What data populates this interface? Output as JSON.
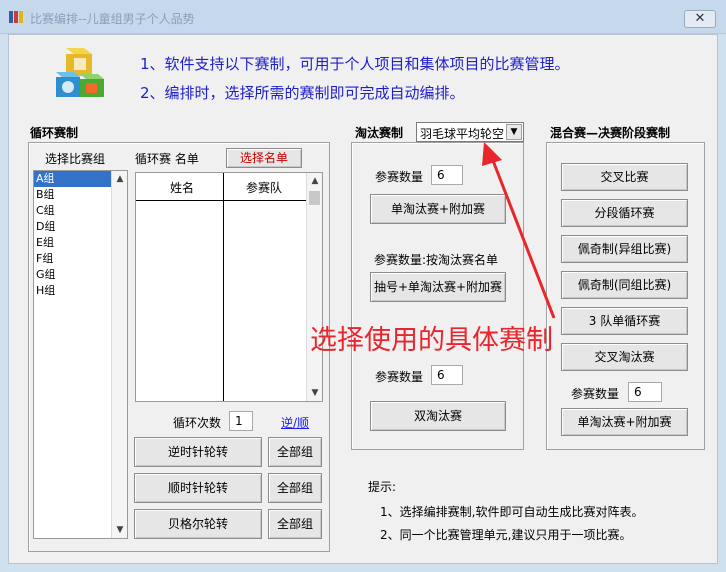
{
  "window": {
    "title": "比赛编排--儿童组男子个人品势",
    "close_glyph": "✕"
  },
  "intro": {
    "line1": "1、软件支持以下赛制，可用于个人项目和集体项目的比赛管理。",
    "line2": "2、编排时，选择所需的赛制即可完成自动编排。"
  },
  "round_robin": {
    "group_label": "循环赛制",
    "select_group_label": "选择比赛组",
    "groups": [
      "A组",
      "B组",
      "C组",
      "D组",
      "E组",
      "F组",
      "G组",
      "H组"
    ],
    "selected_group": "A组",
    "roster_label": "循环赛 名单",
    "select_roster_button": "选择名单",
    "columns": [
      "姓名",
      "参赛队"
    ],
    "cycles_label": "循环次数",
    "cycles_value": "1",
    "reverse_link": "逆/顺",
    "buttons": [
      {
        "label": "逆时针轮转",
        "all": "全部组"
      },
      {
        "label": "顺时针轮转",
        "all": "全部组"
      },
      {
        "label": "贝格尔轮转",
        "all": "全部组"
      }
    ]
  },
  "knockout": {
    "group_label": "淘汰赛制",
    "selected_format": "羽毛球平均轮空",
    "count_label_1": "参赛数量",
    "count_value_1": "6",
    "single_plus_button": "单淘汰赛+附加赛",
    "count_label_2": "参赛数量:按淘汰赛名单",
    "draw_button": "抽号+单淘汰赛+附加赛",
    "count_label_3": "参赛数量",
    "count_value_3": "6",
    "double_button": "双淘汰赛"
  },
  "mixed": {
    "group_label": "混合赛—决赛阶段赛制",
    "buttons": [
      "交叉比赛",
      "分段循环赛",
      "佩奇制(异组比赛)",
      "佩奇制(同组比赛)",
      "3 队单循环赛",
      "交叉淘汰赛"
    ],
    "count_label": "参赛数量",
    "count_value": "6",
    "final_button": "单淘汰赛+附加赛"
  },
  "annotation": {
    "text": "选择使用的具体赛制",
    "color": "#e8262c"
  },
  "tips": {
    "title": "提示:",
    "line1": "1、选择编排赛制,软件即可自动生成比赛对阵表。",
    "line2": "2、同一个比赛管理单元,建议只用于一项比赛。"
  },
  "colors": {
    "intro_text": "#1e1ecc",
    "select_roster_text": "#cc0000",
    "selection": "#3372c9",
    "link": "#1a1aff"
  },
  "icons": [
    "app-icon",
    "close-icon",
    "toy-blocks-icon",
    "chevron-down-icon",
    "scroll-up-icon",
    "scroll-down-icon",
    "red-arrow-icon"
  ]
}
